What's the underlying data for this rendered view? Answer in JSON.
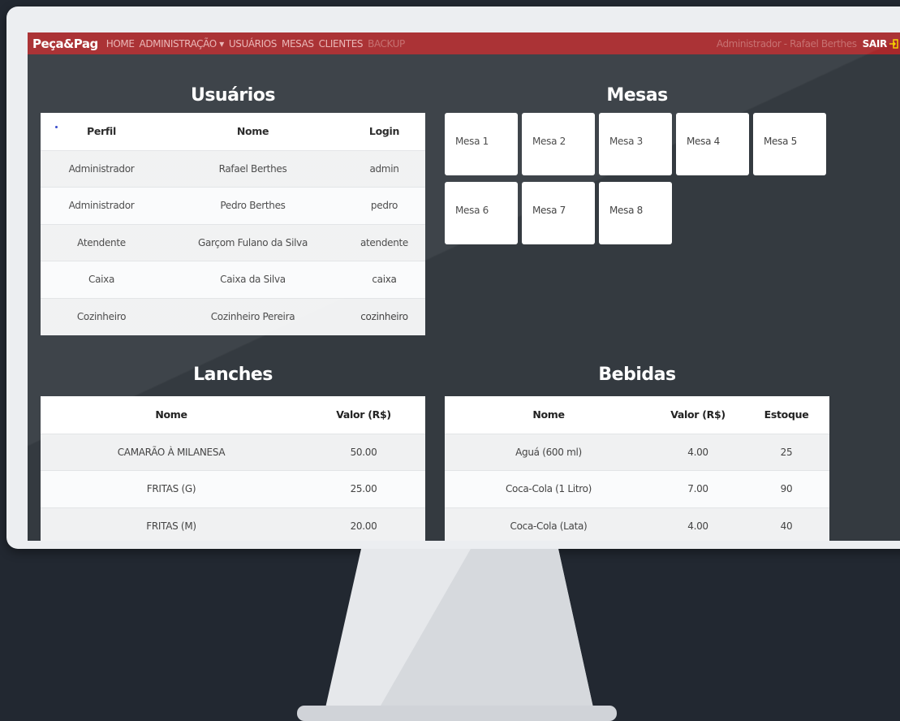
{
  "navbar": {
    "brand": "Peça&Pag",
    "links": [
      "HOME",
      "ADMINISTRAÇÃO ▾",
      "USUÁRIOS",
      "MESAS",
      "CLIENTES",
      "BACKUP"
    ],
    "user": "Administrador - Rafael Berthes",
    "logout": "SAIR"
  },
  "usuarios": {
    "title": "Usuários",
    "headers": [
      "Perfil",
      "Nome",
      "Login"
    ],
    "rows": [
      [
        "Administrador",
        "Rafael Berthes",
        "admin"
      ],
      [
        "Administrador",
        "Pedro Berthes",
        "pedro"
      ],
      [
        "Atendente",
        "Garçom Fulano da Silva",
        "atendente"
      ],
      [
        "Caixa",
        "Caixa da Silva",
        "caixa"
      ],
      [
        "Cozinheiro",
        "Cozinheiro Pereira",
        "cozinheiro"
      ]
    ]
  },
  "mesas": {
    "title": "Mesas",
    "items": [
      "Mesa 1",
      "Mesa 2",
      "Mesa 3",
      "Mesa 4",
      "Mesa 5",
      "Mesa 6",
      "Mesa 7",
      "Mesa 8"
    ]
  },
  "lanches": {
    "title": "Lanches",
    "headers": [
      "Nome",
      "Valor (R$)"
    ],
    "rows": [
      [
        "CAMARÃO À MILANESA",
        "50.00"
      ],
      [
        "FRITAS (G)",
        "25.00"
      ],
      [
        "FRITAS (M)",
        "20.00"
      ]
    ]
  },
  "bebidas": {
    "title": "Bebidas",
    "headers": [
      "Nome",
      "Valor (R$)",
      "Estoque"
    ],
    "rows": [
      [
        "Aguá (600 ml)",
        "4.00",
        "25"
      ],
      [
        "Coca-Cola (1 Litro)",
        "7.00",
        "90"
      ],
      [
        "Coca-Cola (Lata)",
        "4.00",
        "40"
      ]
    ]
  },
  "colors": {
    "navbar": "#a7282b",
    "screen_bg": "#343a40",
    "page_bg": "#222831"
  }
}
